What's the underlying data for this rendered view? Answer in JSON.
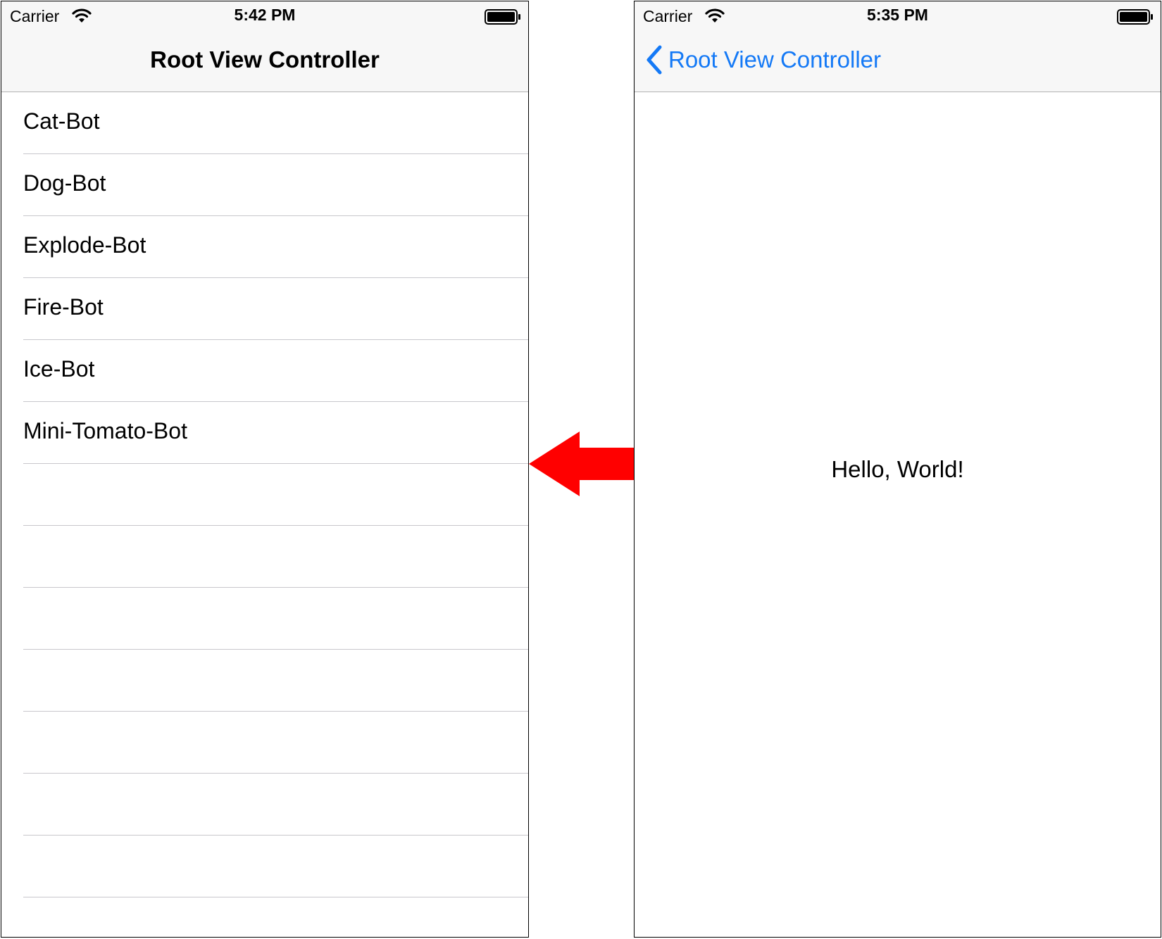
{
  "left_screen": {
    "status_bar": {
      "carrier": "Carrier",
      "time": "5:42 PM"
    },
    "nav_bar": {
      "title": "Root View Controller"
    },
    "table_rows": [
      {
        "label": "Cat-Bot"
      },
      {
        "label": "Dog-Bot"
      },
      {
        "label": "Explode-Bot"
      },
      {
        "label": "Fire-Bot"
      },
      {
        "label": "Ice-Bot"
      },
      {
        "label": "Mini-Tomato-Bot"
      },
      {
        "label": ""
      },
      {
        "label": ""
      },
      {
        "label": ""
      },
      {
        "label": ""
      },
      {
        "label": ""
      },
      {
        "label": ""
      },
      {
        "label": ""
      },
      {
        "label": ""
      }
    ]
  },
  "right_screen": {
    "status_bar": {
      "carrier": "Carrier",
      "time": "5:35 PM"
    },
    "nav_bar": {
      "back_label": "Root View Controller"
    },
    "content": {
      "message": "Hello, World!"
    }
  },
  "icons": {
    "wifi": "wifi-icon",
    "battery": "battery-icon",
    "back": "chevron-left-icon",
    "transition": "arrow-left-icon"
  },
  "colors": {
    "accent": "#1479f6",
    "arrow": "#ff0000",
    "bar_background": "#f7f7f7",
    "separator": "#c8c7cc"
  }
}
